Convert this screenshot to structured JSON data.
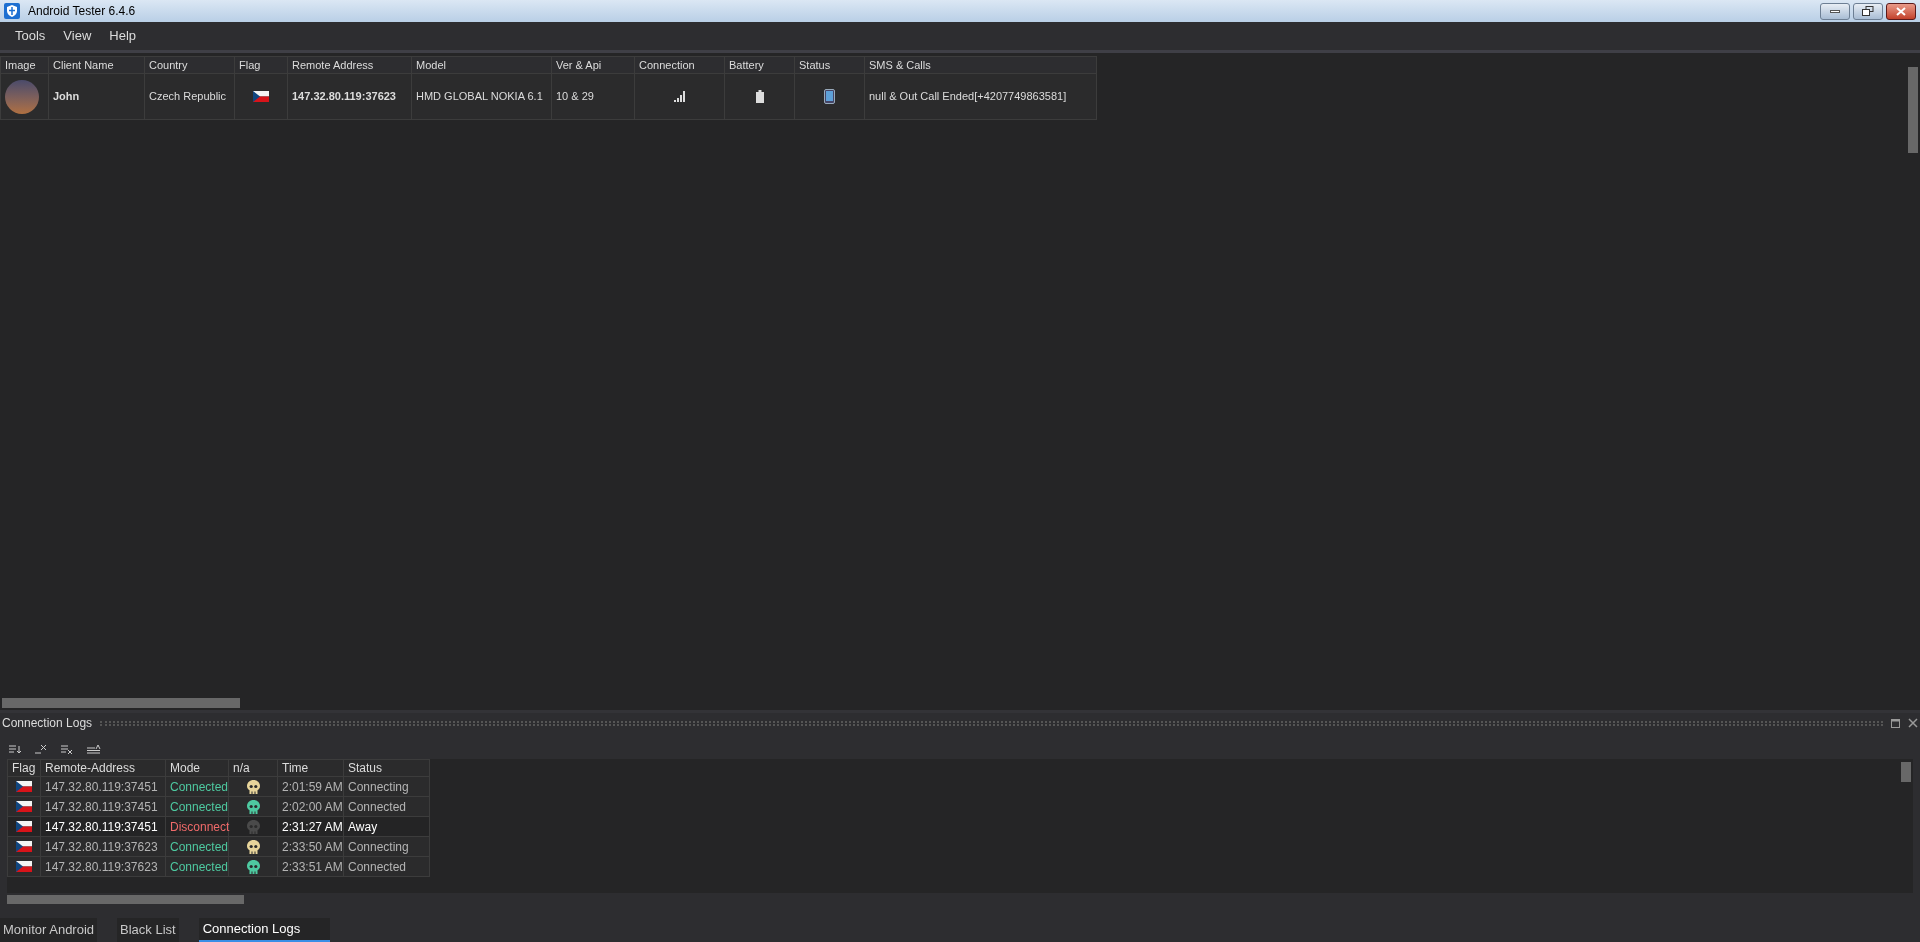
{
  "window": {
    "title": "Android Tester 6.4.6"
  },
  "menu": [
    "Tools",
    "View",
    "Help"
  ],
  "clients": {
    "columns": [
      "Image",
      "Client Name",
      "Country",
      "Flag",
      "Remote Address",
      "Model",
      "Ver & Api",
      "Connection",
      "Battery",
      "Status",
      "SMS & Calls"
    ],
    "rows": [
      {
        "client_name": "John",
        "country": "Czech Republic",
        "remote_address": "147.32.80.119:37623",
        "model": "HMD GLOBAL NOKIA 6.1",
        "ver_api": "10 & 29",
        "sms_calls": "null & Out Call Ended[+4207749863581]"
      }
    ]
  },
  "logs_panel": {
    "title": "Connection Logs",
    "columns": [
      "Flag",
      "Remote-Address",
      "Mode",
      "n/a",
      "Time",
      "Status"
    ],
    "rows": [
      {
        "remote_address": "147.32.80.119:37451",
        "mode": "Connected",
        "kind": "ok",
        "color": "#e8d49a",
        "time": "2:01:59 AM",
        "status": "Connecting",
        "selected": false
      },
      {
        "remote_address": "147.32.80.119:37451",
        "mode": "Connected",
        "kind": "ok",
        "color": "#4ec9a0",
        "time": "2:02:00 AM",
        "status": "Connected",
        "selected": false
      },
      {
        "remote_address": "147.32.80.119:37451",
        "mode": "Disconnect",
        "kind": "bad",
        "color": "#4a4a4a",
        "time": "2:31:27 AM",
        "status": "Away",
        "selected": true
      },
      {
        "remote_address": "147.32.80.119:37623",
        "mode": "Connected",
        "kind": "ok",
        "color": "#e8d49a",
        "time": "2:33:50 AM",
        "status": "Connecting",
        "selected": false
      },
      {
        "remote_address": "147.32.80.119:37623",
        "mode": "Connected",
        "kind": "ok",
        "color": "#4ec9a0",
        "time": "2:33:51 AM",
        "status": "Connected",
        "selected": false
      }
    ]
  },
  "bottom_tabs": [
    {
      "label": "Monitor Android",
      "selected": false
    },
    {
      "label": "Black List",
      "selected": false
    },
    {
      "label": "Connection Logs",
      "selected": true
    }
  ]
}
